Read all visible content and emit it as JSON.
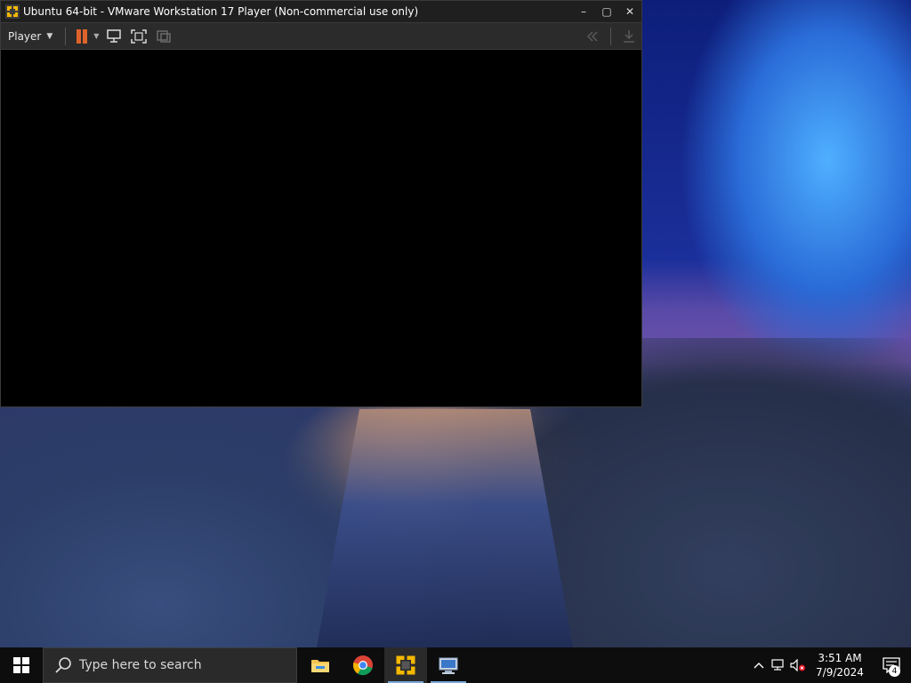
{
  "window": {
    "title": "Ubuntu 64-bit - VMware Workstation 17 Player (Non-commercial use only)",
    "controls": {
      "minimize": "–",
      "restore": "▢",
      "close": "✕"
    }
  },
  "toolbar": {
    "player_menu": "Player",
    "icons": [
      "pause-icon",
      "send-ctrl-alt-del-icon",
      "fullscreen-icon",
      "unity-icon",
      "back-icon",
      "download-icon"
    ]
  },
  "taskbar": {
    "search_placeholder": "Type here to search",
    "apps": [
      "file-explorer-icon",
      "chrome-icon",
      "vmware-player-icon",
      "remote-desktop-icon"
    ],
    "clock_time": "3:51 AM",
    "clock_date": "7/9/2024",
    "notification_count": "4"
  },
  "colors": {
    "titlebar": "#1f1f1f",
    "toolbar": "#2b2b2b",
    "pause_orange": "#e0622a",
    "vmware_yellow": "#f5b800"
  }
}
